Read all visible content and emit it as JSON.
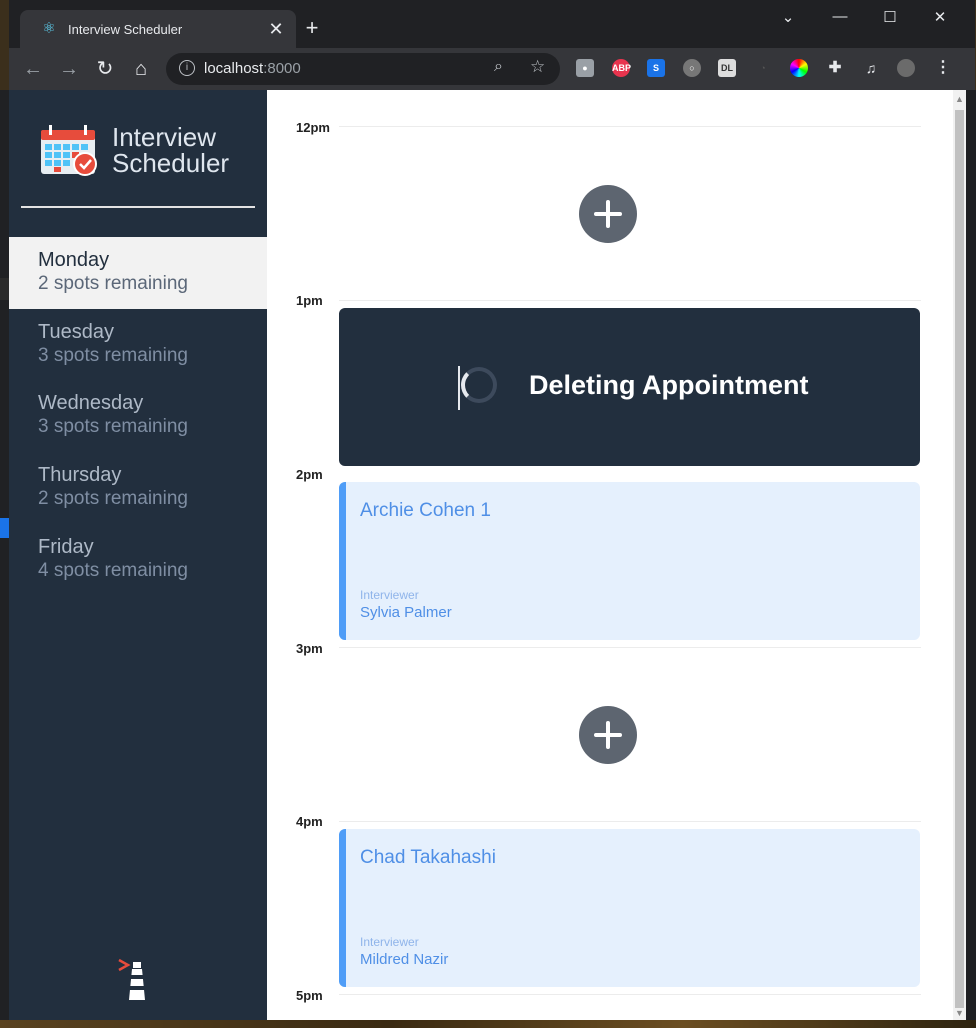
{
  "browser": {
    "tab_title": "Interview Scheduler",
    "url_host": "localhost",
    "url_port": ":8000",
    "new_tab_symbol": "+",
    "close_tab_symbol": "✕"
  },
  "sidebar": {
    "brand_line1": "Interview",
    "brand_line2": "Scheduler",
    "days": [
      {
        "name": "Monday",
        "spots": "2 spots remaining",
        "selected": true
      },
      {
        "name": "Tuesday",
        "spots": "3 spots remaining",
        "selected": false
      },
      {
        "name": "Wednesday",
        "spots": "3 spots remaining",
        "selected": false
      },
      {
        "name": "Thursday",
        "spots": "2 spots remaining",
        "selected": false
      },
      {
        "name": "Friday",
        "spots": "4 spots remaining",
        "selected": false
      }
    ]
  },
  "schedule": {
    "slots": [
      "12pm",
      "1pm",
      "2pm",
      "3pm",
      "4pm",
      "5pm"
    ],
    "status_message": "Deleting Appointment",
    "appointments": [
      {
        "student": "Archie Cohen 1",
        "interviewer_label": "Interviewer",
        "interviewer": "Sylvia Palmer"
      },
      {
        "student": "Chad Takahashi",
        "interviewer_label": "Interviewer",
        "interviewer": "Mildred Nazir"
      }
    ]
  },
  "colors": {
    "sidebar_bg": "#222f3e",
    "accent": "#4f9df7",
    "appointment_bg": "#e5f0fd",
    "add_button": "#5d6570"
  }
}
